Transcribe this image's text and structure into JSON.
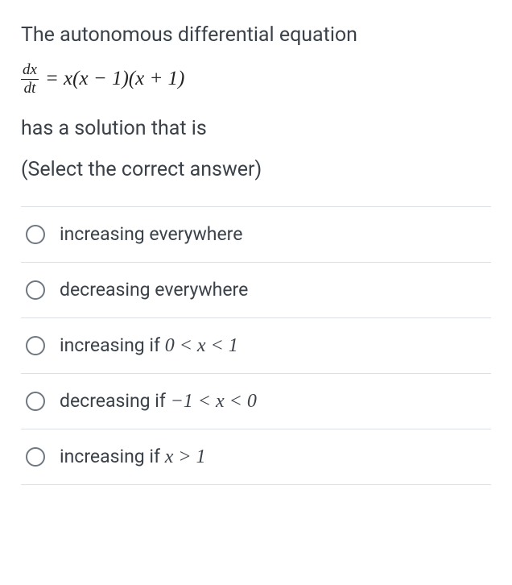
{
  "question": {
    "line1": "The autonomous differential equation",
    "equation": {
      "frac_num": "dx",
      "frac_den": "dt",
      "rhs": " = x(x − 1)(x + 1)"
    },
    "line2": "has a solution that is",
    "instruction": "(Select the correct answer)"
  },
  "options": [
    {
      "text": "increasing everywhere",
      "math": ""
    },
    {
      "text": "decreasing everywhere",
      "math": ""
    },
    {
      "text": "increasing if ",
      "math": "0 < x < 1"
    },
    {
      "text": "decreasing if ",
      "math": "−1 < x < 0"
    },
    {
      "text": "increasing if ",
      "math": "x > 1"
    }
  ]
}
